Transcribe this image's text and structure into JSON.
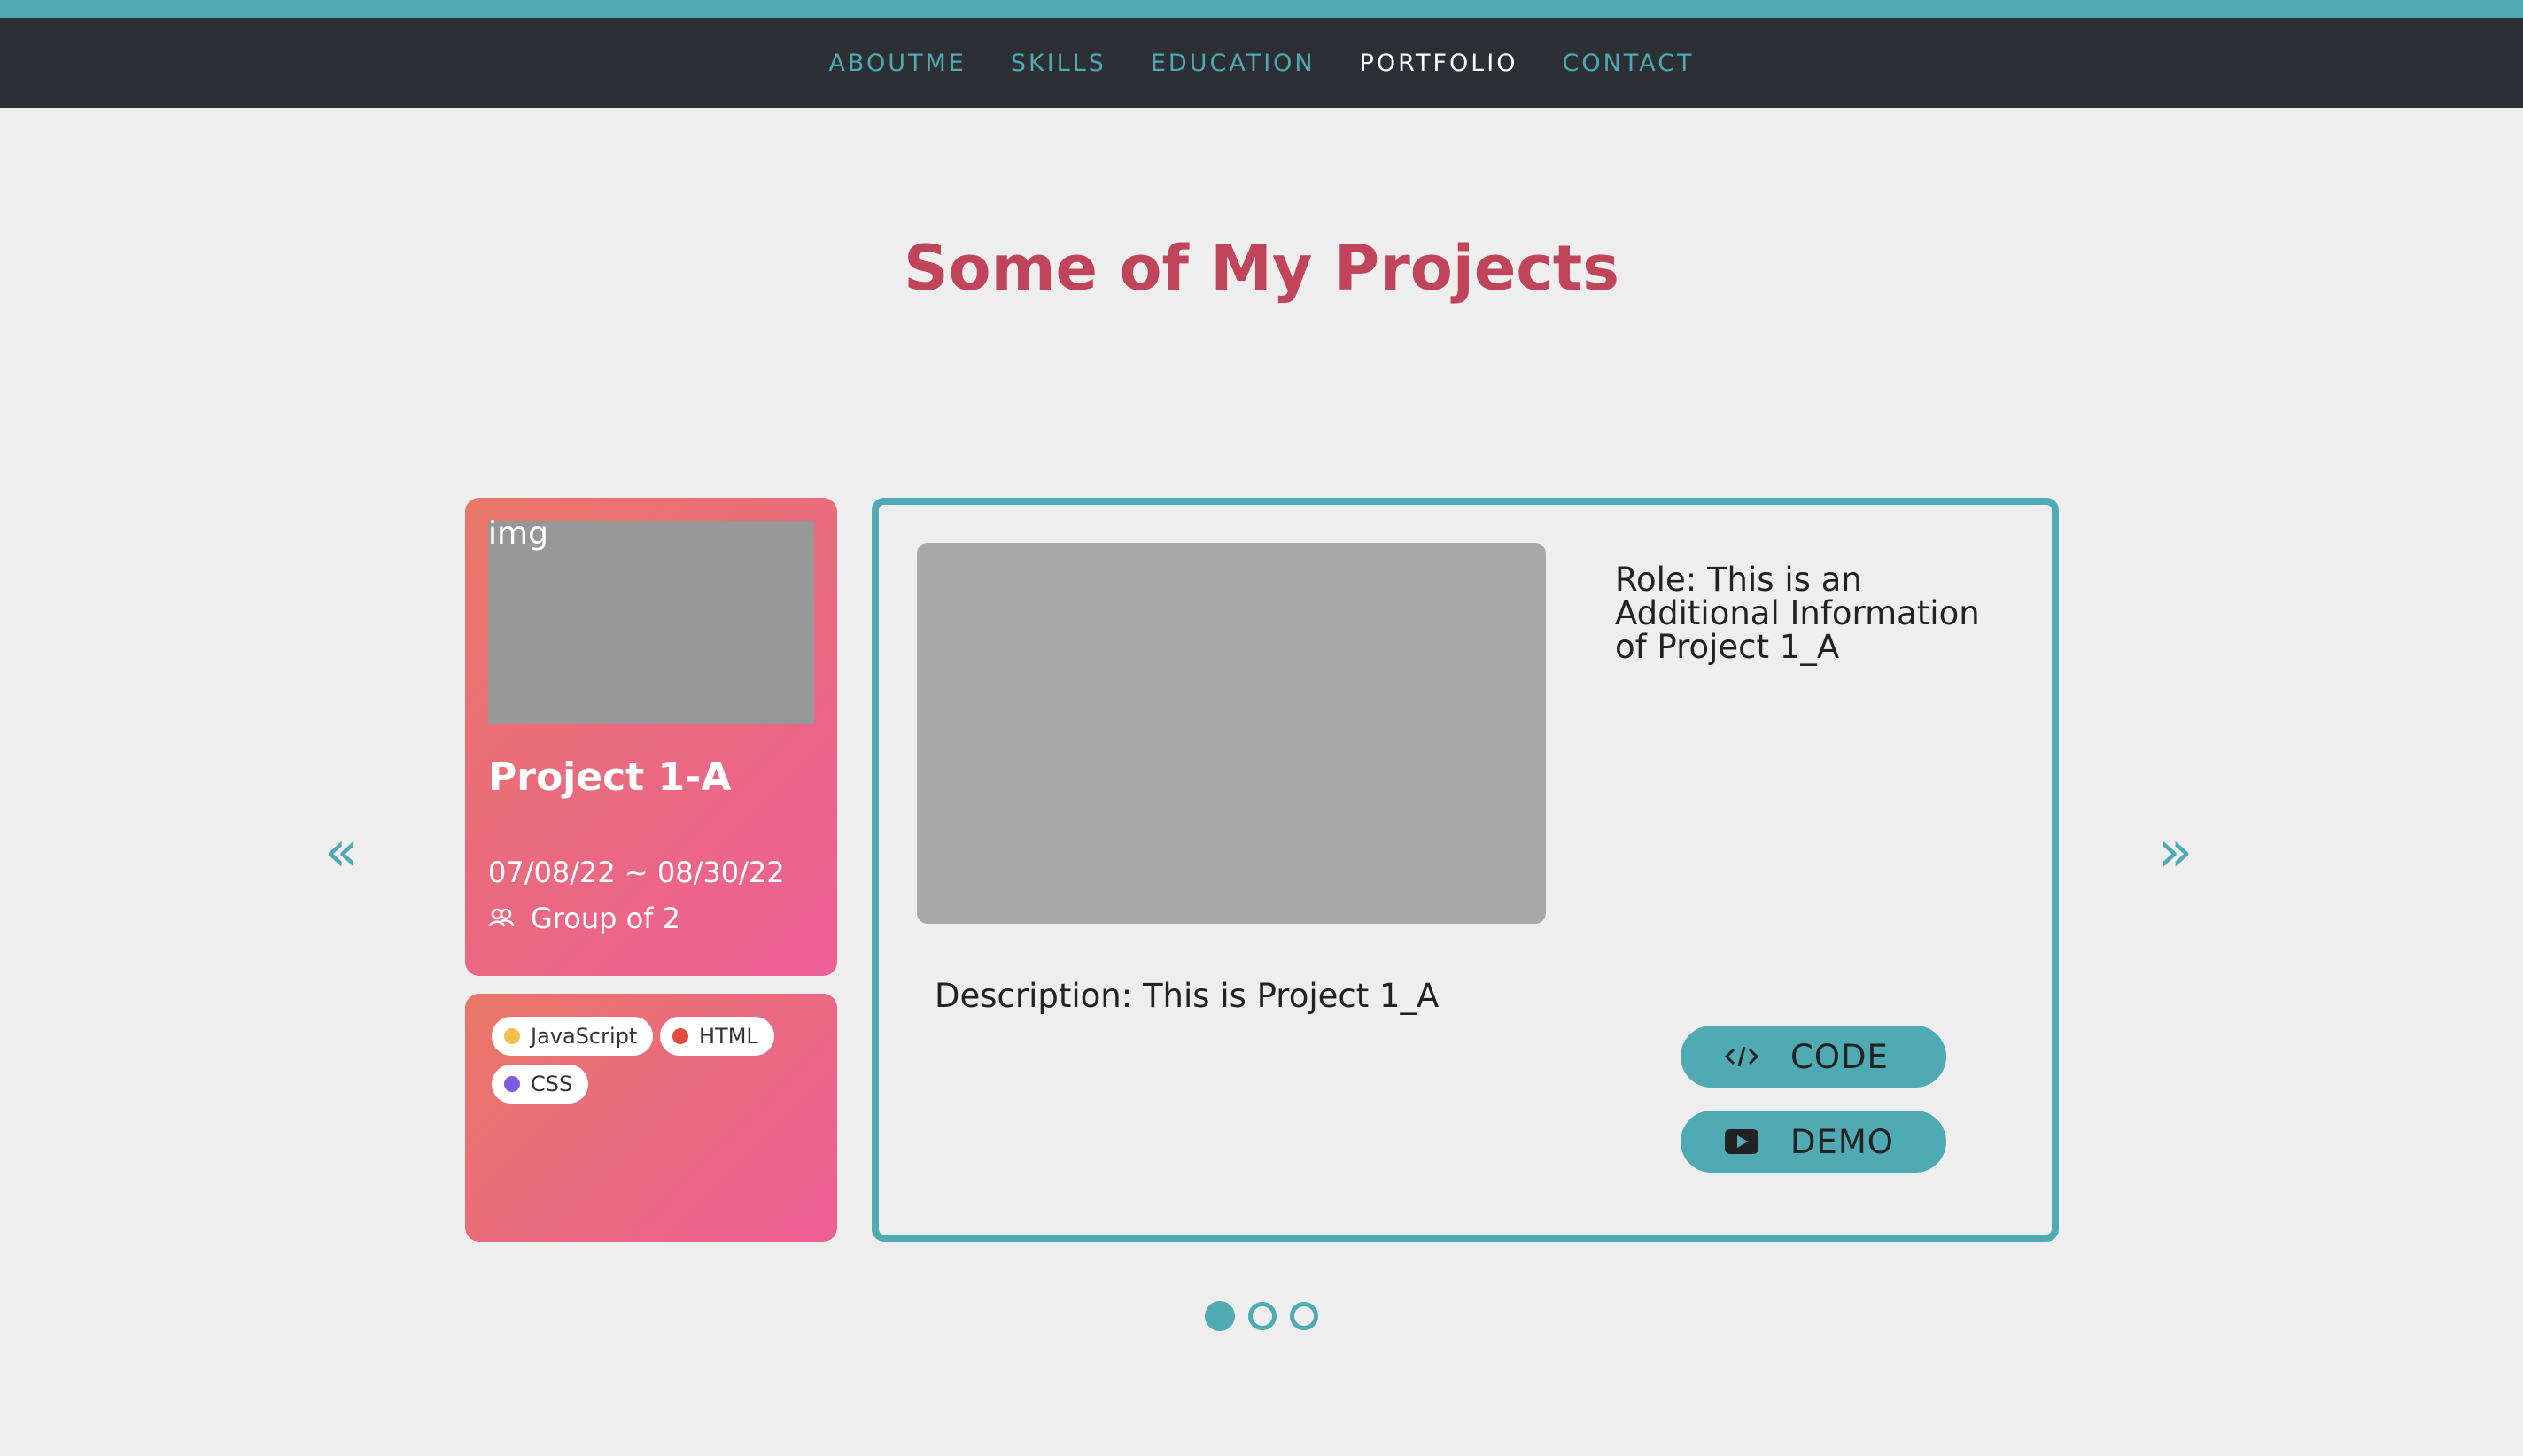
{
  "nav": {
    "items": [
      {
        "label": "ABOUTME",
        "active": false
      },
      {
        "label": "SKILLS",
        "active": false
      },
      {
        "label": "EDUCATION",
        "active": false
      },
      {
        "label": "PORTFOLIO",
        "active": true
      },
      {
        "label": "CONTACT",
        "active": false
      }
    ]
  },
  "page": {
    "title": "Some of My Projects"
  },
  "carousel": {
    "prev_icon": "double-chevron-left-icon",
    "next_icon": "double-chevron-right-icon",
    "pagination_count": 3,
    "active_index": 0
  },
  "project": {
    "image_label": "img",
    "name": "Project 1-A",
    "date_range": "07/08/22 ~ 08/30/22",
    "group": "Group of 2",
    "tags": [
      {
        "label": "JavaScript",
        "color": "#f2c14e"
      },
      {
        "label": "HTML",
        "color": "#e24a3b"
      },
      {
        "label": "CSS",
        "color": "#7c5ce6"
      }
    ],
    "role": "Role: This is an Additional Information of Project 1_A",
    "description": "Description: This is Project 1_A",
    "buttons": {
      "code_label": "CODE",
      "demo_label": "DEMO"
    }
  },
  "colors": {
    "accent": "#4faab4",
    "title": "#c0445a",
    "nav_bg": "#2c2f33",
    "card_gradient_start": "#e97868",
    "card_gradient_end": "#ec5f96"
  }
}
